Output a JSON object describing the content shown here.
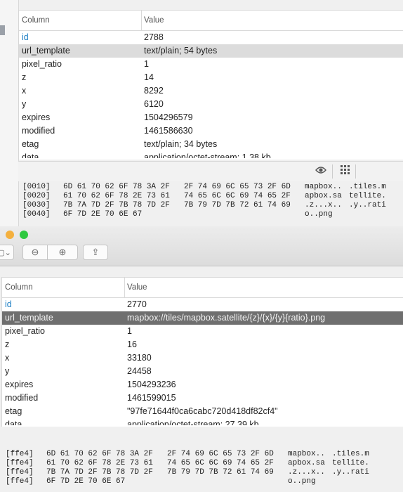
{
  "top_window": {
    "columns": [
      "Column",
      "Value"
    ],
    "rows": [
      {
        "column": "id",
        "value": "2788"
      },
      {
        "column": "url_template",
        "value": "text/plain; 54 bytes"
      },
      {
        "column": "pixel_ratio",
        "value": "1"
      },
      {
        "column": "z",
        "value": "14"
      },
      {
        "column": "x",
        "value": "8292"
      },
      {
        "column": "y",
        "value": "6120"
      },
      {
        "column": "expires",
        "value": "1504296579"
      },
      {
        "column": "modified",
        "value": "1461586630"
      },
      {
        "column": "etag",
        "value": "text/plain; 34 bytes"
      },
      {
        "column": "data",
        "value": "application/octet-stream; 1.38 kb"
      }
    ],
    "viewer_icons": [
      "eye-icon",
      "grid-icon"
    ],
    "hex": [
      {
        "offset": "[0010]",
        "bytes1": "6D 61 70 62 6F 78 3A 2F",
        "bytes2": "2F 74 69 6C 65 73 2F 6D",
        "ascii1": "mapbox..",
        "ascii2": ".tiles.m"
      },
      {
        "offset": "[0020]",
        "bytes1": "61 70 62 6F 78 2E 73 61",
        "bytes2": "74 65 6C 6C 69 74 65 2F",
        "ascii1": "apbox.sa",
        "ascii2": "tellite."
      },
      {
        "offset": "[0030]",
        "bytes1": "7B 7A 7D 2F 7B 78 7D 2F",
        "bytes2": "7B 79 7D 7B 72 61 74 69",
        "ascii1": ".z...x..",
        "ascii2": ".y..rati"
      },
      {
        "offset": "[0040]",
        "bytes1": "6F 7D 2E 70 6E 67",
        "bytes2": "",
        "ascii1": "o..png",
        "ascii2": ""
      }
    ]
  },
  "toolbar": {
    "colors": {
      "close": "#f4b03e",
      "zoom": "#2fc840"
    },
    "icons": [
      "sidebar-toggle-icon",
      "zoom-out-icon",
      "zoom-in-icon",
      "share-icon"
    ],
    "zoom_out": "⊖",
    "zoom_in": "⊕",
    "share": "⇪",
    "sidebar": "▢⌄"
  },
  "bottom_window": {
    "columns": [
      "Column",
      "Value"
    ],
    "rows": [
      {
        "column": "id",
        "value": "2770"
      },
      {
        "column": "url_template",
        "value": "mapbox://tiles/mapbox.satellite/{z}/{x}/{y}{ratio}.png"
      },
      {
        "column": "pixel_ratio",
        "value": "1"
      },
      {
        "column": "z",
        "value": "16"
      },
      {
        "column": "x",
        "value": "33180"
      },
      {
        "column": "y",
        "value": "24458"
      },
      {
        "column": "expires",
        "value": "1504293236"
      },
      {
        "column": "modified",
        "value": "1461599015"
      },
      {
        "column": "etag",
        "value": "\"97fe71644f0ca6cabc720d418df82cf4\""
      },
      {
        "column": "data",
        "value": "application/octet-stream; 27.39 kb"
      }
    ],
    "hex": [
      {
        "offset": "[ffe4]",
        "bytes1": "6D 61 70 62 6F 78 3A 2F",
        "bytes2": "2F 74 69 6C 65 73 2F 6D",
        "ascii1": "mapbox..",
        "ascii2": ".tiles.m"
      },
      {
        "offset": "[ffe4]",
        "bytes1": "61 70 62 6F 78 2E 73 61",
        "bytes2": "74 65 6C 6C 69 74 65 2F",
        "ascii1": "apbox.sa",
        "ascii2": "tellite."
      },
      {
        "offset": "[ffe4]",
        "bytes1": "7B 7A 7D 2F 7B 78 7D 2F",
        "bytes2": "7B 79 7D 7B 72 61 74 69",
        "ascii1": ".z...x..",
        "ascii2": ".y..rati"
      },
      {
        "offset": "[ffe4]",
        "bytes1": "6F 7D 2E 70 6E 67",
        "bytes2": "",
        "ascii1": "o..png",
        "ascii2": ""
      }
    ]
  }
}
